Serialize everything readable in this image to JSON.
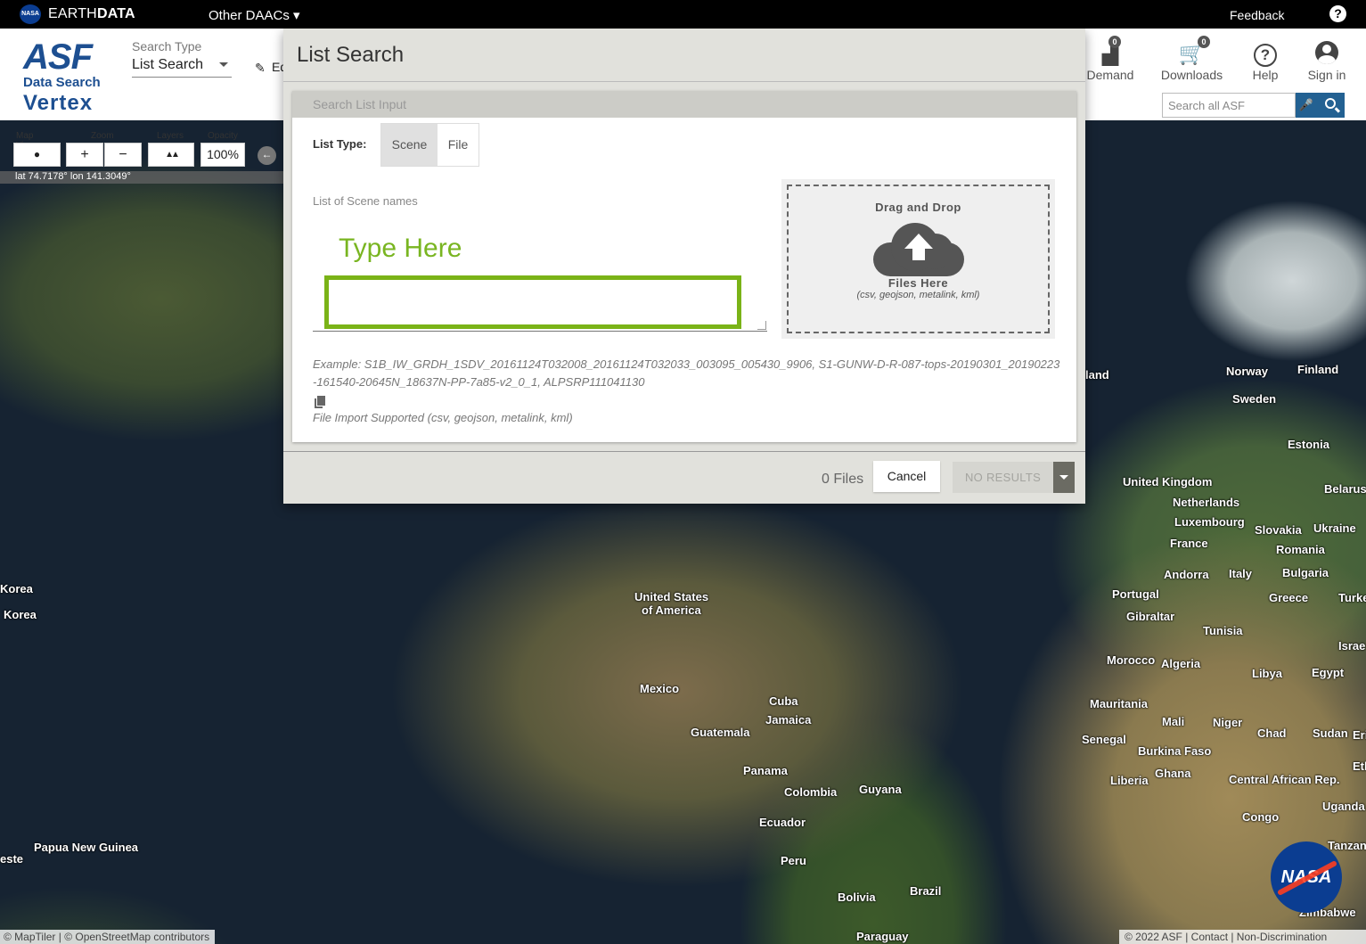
{
  "topbar": {
    "nasa_logo": "NASA",
    "brand_thin": "EARTH",
    "brand_bold": "DATA",
    "other_daacs": "Other DAACs ▾",
    "feedback": "Feedback",
    "help_icon": "?"
  },
  "header": {
    "logo_asf": "ASF",
    "logo_ds": "Data Search",
    "logo_vertex": "Vertex",
    "search_type_label": "Search Type",
    "search_type_value": "List Search",
    "edit_text": "Ed",
    "buttons": {
      "demand": "Demand",
      "demand_count": "0",
      "downloads": "Downloads",
      "downloads_count": "0",
      "help": "Help",
      "help_glyph": "?",
      "signin": "Sign in"
    },
    "search_placeholder": "Search all ASF",
    "mic_icon": "🎤"
  },
  "map_controls": {
    "map_view_label": "Map View",
    "zoom_label": "Zoom",
    "layers_label": "Layers",
    "opacity_label": "Opacity",
    "globe_icon": "●",
    "zoom_in": "+",
    "zoom_out": "−",
    "layers_icon": "▲▲",
    "opacity_value": "100%",
    "back_icon": "←",
    "coords": "lat 74.7178°   lon 141.3049°"
  },
  "modal": {
    "title": "List Search",
    "panel_header": "Search List Input",
    "list_type_label": "List Type:",
    "toggle_scene": "Scene",
    "toggle_file": "File",
    "scene_list_label": "List of Scene names",
    "type_here": "Type Here",
    "textarea_value": "",
    "dropzone_title": "Drag and Drop",
    "dropzone_files": "Files Here",
    "dropzone_types": "(csv, geojson, metalink, kml)",
    "example": "Example: S1B_IW_GRDH_1SDV_20161124T032008_20161124T032033_003095_005430_9906, S1-GUNW-D-R-087-tops-20190301_20190223-161540-20645N_18637N-PP-7a85-v2_0_1, ALPSRP111041130",
    "file_import": "File Import Supported (csv, geojson, metalink, kml)",
    "file_count": "0 Files",
    "cancel": "Cancel",
    "no_results": "NO RESULTS"
  },
  "map_labels": [
    "Norway",
    "Finland",
    "Sweden",
    "Estonia",
    "United Kingdom",
    "Belarus",
    "Netherlands",
    "Luxembourg",
    "Slovakia",
    "Ukraine",
    "France",
    "Romania",
    "Andorra",
    "Italy",
    "Bulgaria",
    "Portugal",
    "Greece",
    "Turke",
    "Gibraltar",
    "Tunisia",
    "Israe",
    "Morocco",
    "Algeria",
    "Libya",
    "Egypt",
    "Mauritania",
    "Mali",
    "Niger",
    "Chad",
    "Sudan",
    "Eri",
    "Senegal",
    "Burkina Faso",
    "Eth",
    "Liberia",
    "Ghana",
    "Central African Rep.",
    "Uganda",
    "Congo",
    "Tanzan",
    "Zimbabwe",
    "land",
    "Korea",
    "Korea",
    "United States",
    "of America",
    "Mexico",
    "Cuba",
    "Jamaica",
    "Guatemala",
    "Panama",
    "Colombia",
    "Guyana",
    "Ecuador",
    "Peru",
    "Brazil",
    "Bolivia",
    "Paraguay",
    "Papua New Guinea",
    "este"
  ],
  "attribution": {
    "left": "© MapTiler | © OpenStreetMap contributors",
    "right": "© 2022 ASF   |  Contact   |  Non-Discrimination"
  },
  "nasa_corner_logo": "NASA",
  "colors": {
    "accent_green": "#79b521",
    "asf_blue": "#1d4f91",
    "search_blue": "#236192"
  }
}
